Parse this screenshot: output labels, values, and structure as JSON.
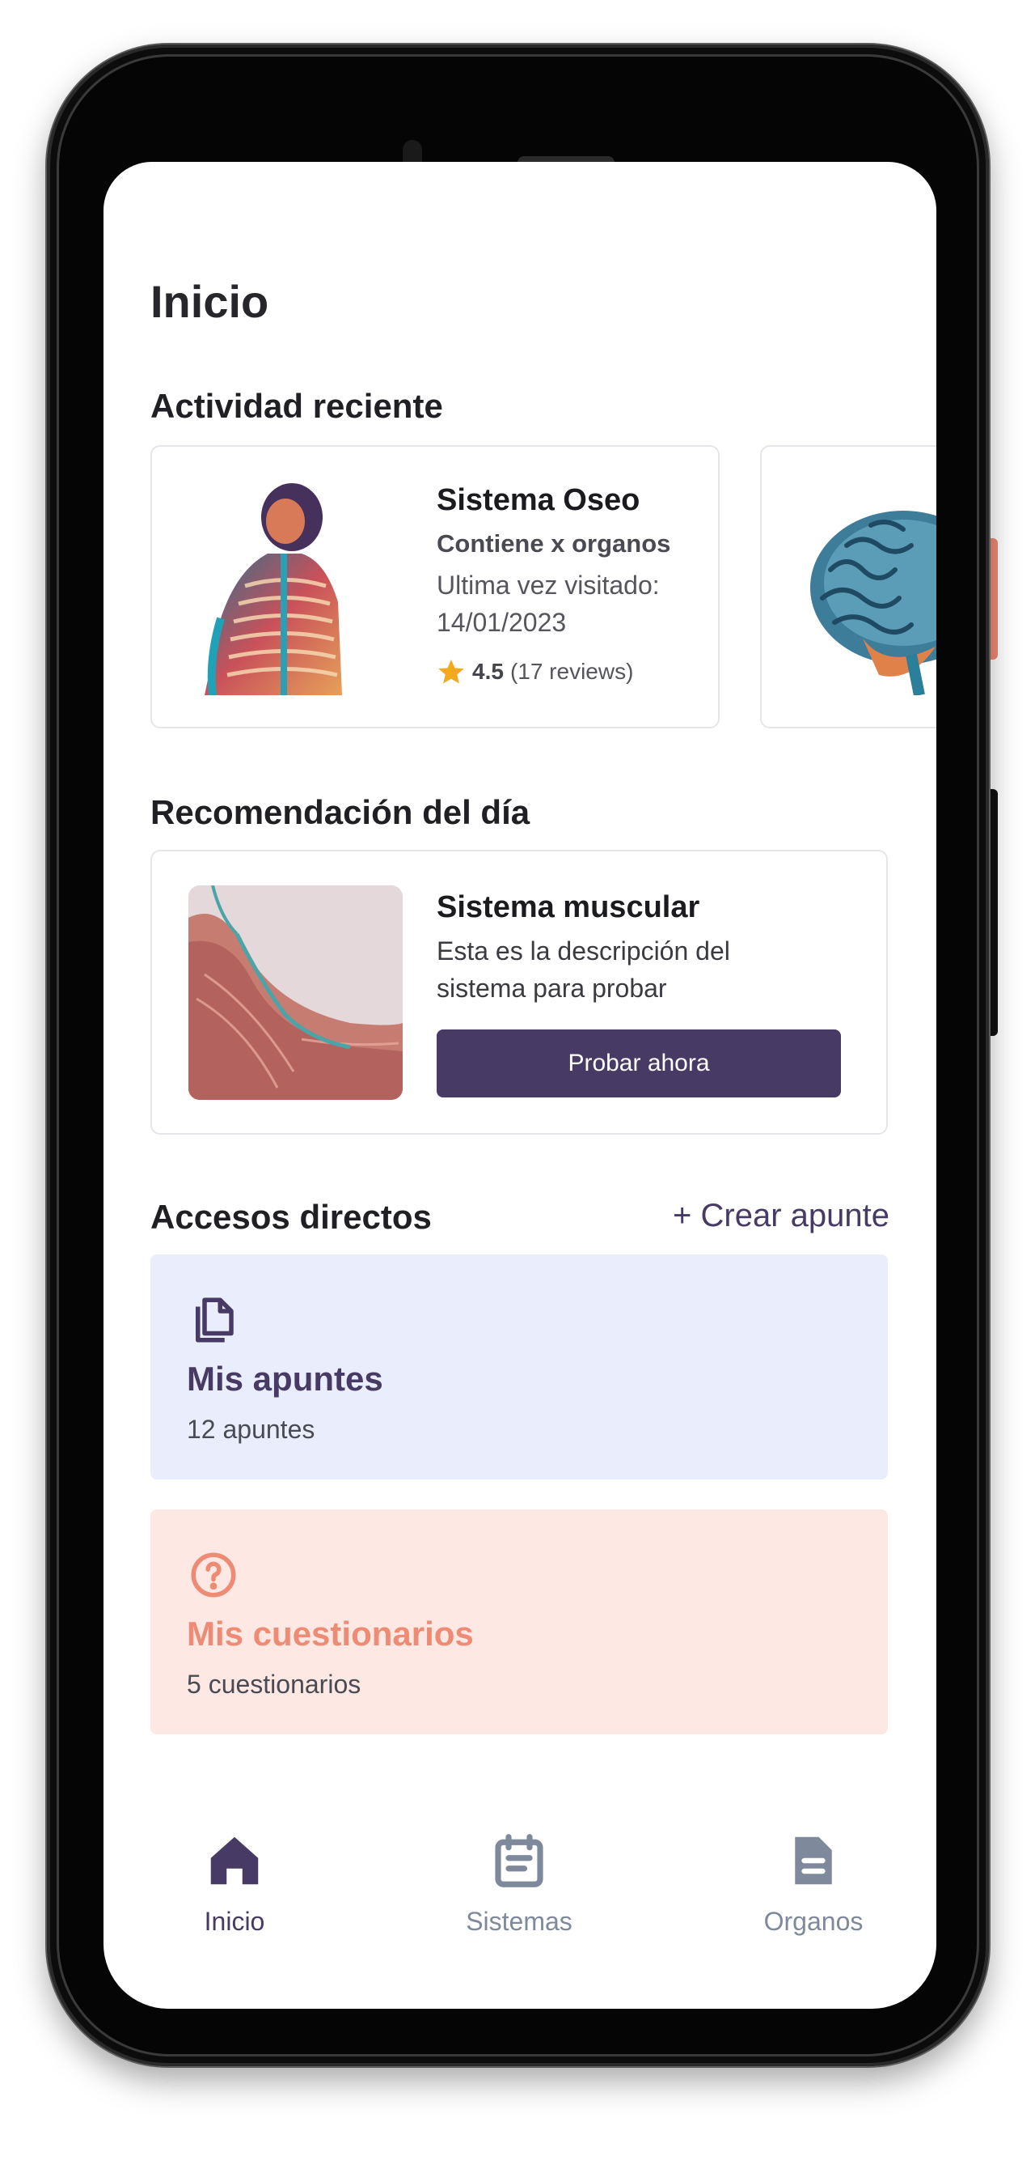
{
  "page": {
    "title": "Inicio"
  },
  "recent": {
    "section_title": "Actividad reciente",
    "cards": [
      {
        "title": "Sistema Oseo",
        "subtitle": "Contiene x organos",
        "visited": "Ultima vez visitado: 14/01/2023",
        "rating": "4.5",
        "reviews": "(17 reviews)",
        "image": "skeleton-image"
      },
      {
        "image": "brain-image"
      }
    ]
  },
  "recommendation": {
    "section_title": "Recomendación del día",
    "title": "Sistema muscular",
    "description": "Esta es la descripción del sistema para probar",
    "button_label": "Probar ahora",
    "image": "muscle-image"
  },
  "shortcuts": {
    "section_title": "Accesos directos",
    "create_label": "+ Crear apunte",
    "items": [
      {
        "title": "Mis apuntes",
        "count": "12 apuntes",
        "icon": "notes-icon",
        "color": "#473a64",
        "bg": "#eaedfc"
      },
      {
        "title": "Mis cuestionarios",
        "count": "5 cuestionarios",
        "icon": "question-icon",
        "color": "#ee8b75",
        "bg": "#fde8e3"
      }
    ]
  },
  "nav": {
    "items": [
      {
        "label": "Inicio",
        "icon": "home-icon",
        "active": true
      },
      {
        "label": "Sistemas",
        "icon": "calendar-icon",
        "active": false
      },
      {
        "label": "Organos",
        "icon": "document-icon",
        "active": false
      }
    ],
    "active_color": "#473a64",
    "inactive_color": "#7e8a9c"
  },
  "colors": {
    "brand": "#473a64",
    "accent": "#ee8b75",
    "star": "#f2a91d"
  }
}
